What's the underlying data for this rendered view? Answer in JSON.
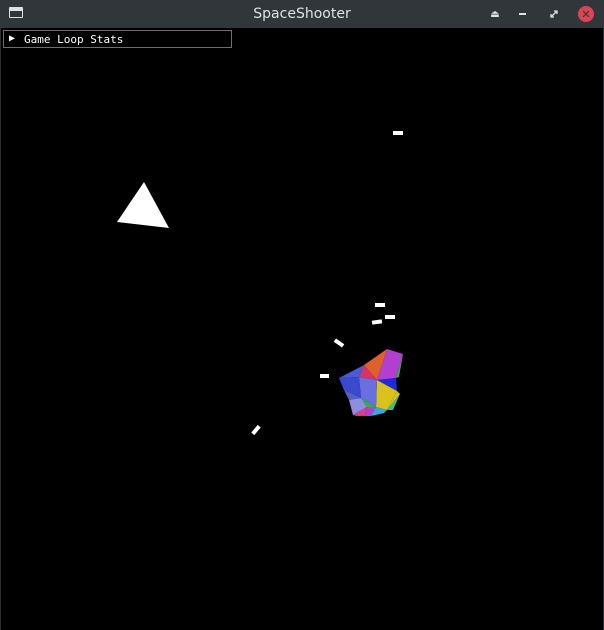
{
  "window": {
    "title": "SpaceShooter",
    "controls": [
      "eject-icon",
      "minimize-icon",
      "restore-icon",
      "close-icon"
    ]
  },
  "debug_panel": {
    "label": "Game Loop Stats",
    "expanded": false,
    "arrow": "▶"
  },
  "scene": {
    "background": "#000000",
    "ship_color": "#ffffff",
    "bullet_color": "#ffffff",
    "asteroid_palette": [
      "#4b5bd6",
      "#e03c8a",
      "#d8c21b",
      "#2db34a",
      "#b33fd1",
      "#3aa8d8",
      "#e0602a",
      "#6a6fe0"
    ]
  }
}
